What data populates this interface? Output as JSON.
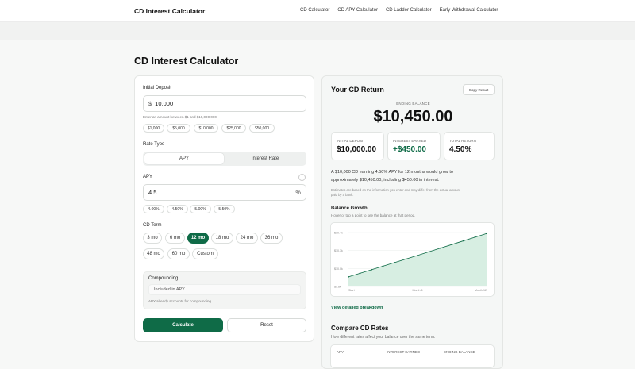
{
  "header": {
    "brand": "CD Interest Calculator",
    "nav": [
      "CD Calculator",
      "CD APY Calculator",
      "CD Ladder Calculator",
      "Early Withdrawal Calculator"
    ]
  },
  "page_title": "CD Interest Calculator",
  "form": {
    "deposit_label": "Initial Deposit",
    "deposit_prefix": "$",
    "deposit_value": "10,000",
    "deposit_hint": "Enter an amount between $1 and $10,000,000.",
    "deposit_chips": [
      "$1,000",
      "$5,000",
      "$10,000",
      "$25,000",
      "$50,000"
    ],
    "rate_type_label": "Rate Type",
    "rate_types": [
      "APY",
      "Interest Rate"
    ],
    "rate_label": "APY",
    "info_icon": "info-icon",
    "rate_value": "4.5",
    "rate_suffix": "%",
    "rate_chips": [
      "4.00%",
      "4.50%",
      "5.00%",
      "5.50%"
    ],
    "term_label": "CD Term",
    "terms": [
      "3 mo",
      "6 mo",
      "12 mo",
      "18 mo",
      "24 mo",
      "36 mo",
      "48 mo",
      "60 mo",
      "Custom"
    ],
    "compounding_label": "Compounding",
    "compounding_value": "Included in APY",
    "compounding_note": "APY already accounts for compounding.",
    "calculate": "Calculate",
    "reset": "Reset"
  },
  "result": {
    "title": "Your CD Return",
    "copy": "Copy Result",
    "ending_label": "ENDING BALANCE",
    "ending_value": "$10,450.00",
    "stats": [
      {
        "label": "INITIAL DEPOSIT",
        "value": "$10,000.00"
      },
      {
        "label": "INTEREST EARNED",
        "value": "+$450.00"
      },
      {
        "label": "TOTAL RETURN",
        "value": "4.50%"
      }
    ],
    "summary_a": "A $10,000 CD earning 4.50% APY for 12 months would grow to",
    "summary_b": "approximately $10,450.00, including $450.00 in interest.",
    "disclaimer_a": "Estimates are based on the information you enter and may differ from the actual amount",
    "disclaimer_b": "paid by a bank.",
    "growth_title": "Balance Growth",
    "growth_sub": "Hover or tap a point to see the balance at that period.",
    "breakdown_link": "View detailed breakdown",
    "compare_title": "Compare CD Rates",
    "compare_sub": "How different rates affect your balance over the same term.",
    "table_headers": [
      "APY",
      "INTEREST EARNED",
      "ENDING BALANCE"
    ]
  },
  "chart_data": {
    "type": "area",
    "title": "",
    "xlabel": "",
    "ylabel": "",
    "x_ticks": [
      "Start",
      "Month 6",
      "Month 12"
    ],
    "y_ticks": [
      "$9.8k",
      "$10.0k",
      "$10.3k",
      "$10.4k"
    ],
    "x": [
      0,
      1,
      2,
      3,
      4,
      5,
      6,
      7,
      8,
      9,
      10,
      11,
      12
    ],
    "values": [
      10000,
      10037,
      10074,
      10111,
      10148,
      10185,
      10222,
      10260,
      10298,
      10336,
      10374,
      10412,
      10450
    ],
    "ylim": [
      9900,
      10460
    ],
    "accent": "#0f6b47"
  }
}
